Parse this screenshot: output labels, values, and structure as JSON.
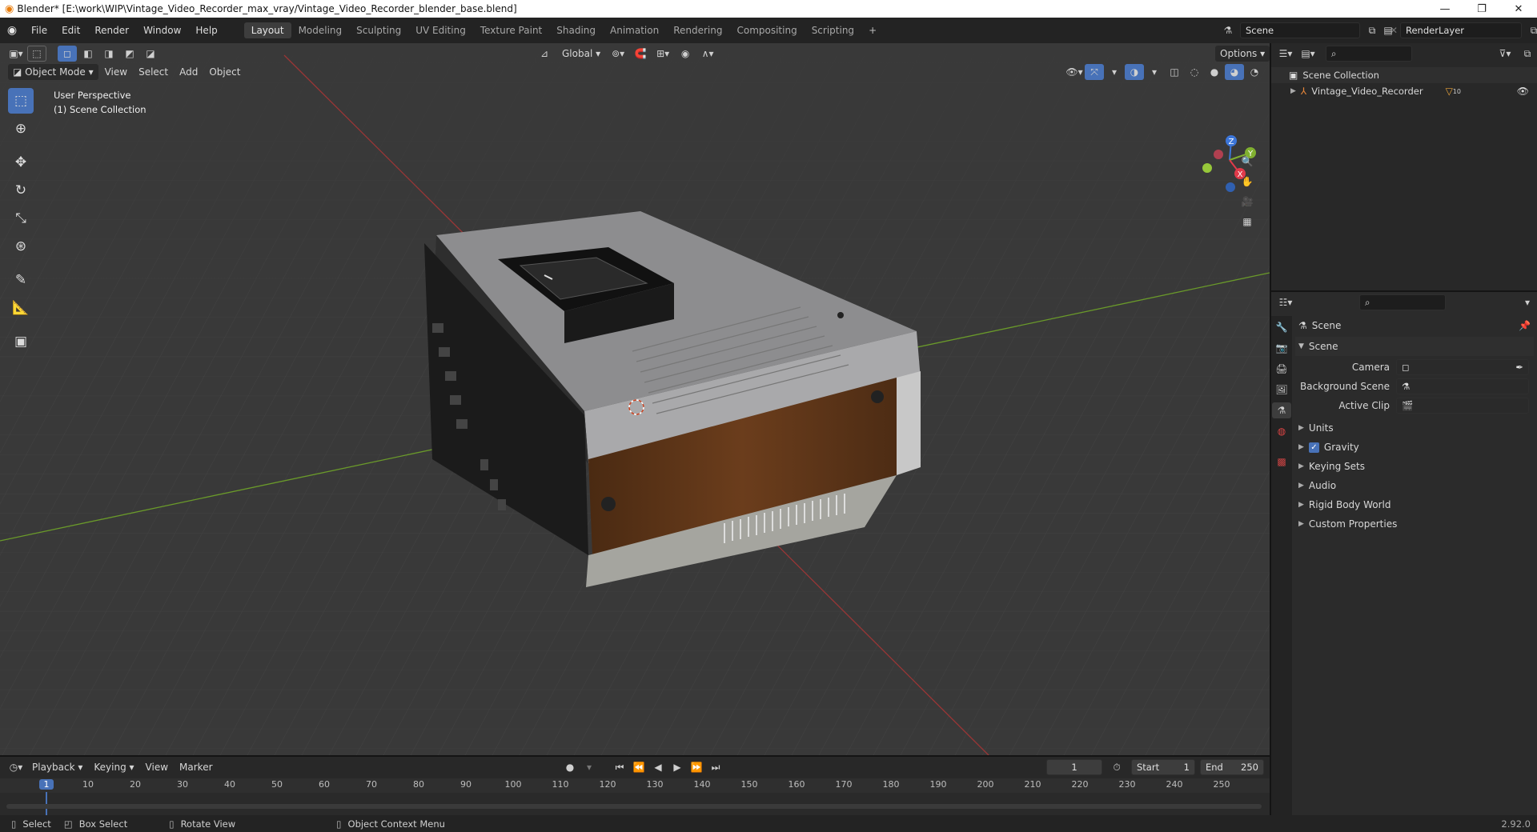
{
  "titlebar": {
    "title": "Blender* [E:\\work\\WIP\\Vintage_Video_Recorder_max_vray/Vintage_Video_Recorder_blender_base.blend]",
    "minimize": "—",
    "restore": "❐",
    "close": "✕"
  },
  "menus": [
    "File",
    "Edit",
    "Render",
    "Window",
    "Help"
  ],
  "workspaces": [
    "Layout",
    "Modeling",
    "Sculpting",
    "UV Editing",
    "Texture Paint",
    "Shading",
    "Animation",
    "Rendering",
    "Compositing",
    "Scripting"
  ],
  "active_workspace": "Layout",
  "add_workspace": "+",
  "scene_field": "Scene",
  "renderlayer_field": "RenderLayer",
  "viewport": {
    "mode": "Object Mode",
    "menus": [
      "View",
      "Select",
      "Add",
      "Object"
    ],
    "orientation": "Global",
    "options": "Options",
    "overlay_line1": "User Perspective",
    "overlay_line2": "(1) Scene Collection",
    "gizmo": {
      "x": "X",
      "y": "Y",
      "z": "Z"
    }
  },
  "outliner": {
    "root": "Scene Collection",
    "object": "Vintage_Video_Recorder",
    "modifier_count": "10"
  },
  "properties": {
    "context": "Scene",
    "panel_title": "Scene",
    "camera_label": "Camera",
    "background_scene_label": "Background Scene",
    "active_clip_label": "Active Clip",
    "sections": [
      "Units",
      "Gravity",
      "Keying Sets",
      "Audio",
      "Rigid Body World",
      "Custom Properties"
    ],
    "gravity_checked": true
  },
  "timeline": {
    "menus": [
      "Playback",
      "Keying",
      "View",
      "Marker"
    ],
    "current_frame": "1",
    "start_label": "Start",
    "start_value": "1",
    "end_label": "End",
    "end_value": "250",
    "ruler": [
      "1",
      "10",
      "20",
      "30",
      "40",
      "50",
      "60",
      "70",
      "80",
      "90",
      "100",
      "110",
      "120",
      "130",
      "140",
      "150",
      "160",
      "170",
      "180",
      "190",
      "200",
      "210",
      "220",
      "230",
      "240",
      "250"
    ]
  },
  "statusbar": {
    "select": "Select",
    "box_select": "Box Select",
    "rotate_view": "Rotate View",
    "context_menu": "Object Context Menu",
    "version": "2.92.0"
  },
  "colors": {
    "accent": "#4872b8",
    "x_axis": "#9a3636",
    "y_axis": "#6a9a2a",
    "wood": "#5a3418"
  }
}
